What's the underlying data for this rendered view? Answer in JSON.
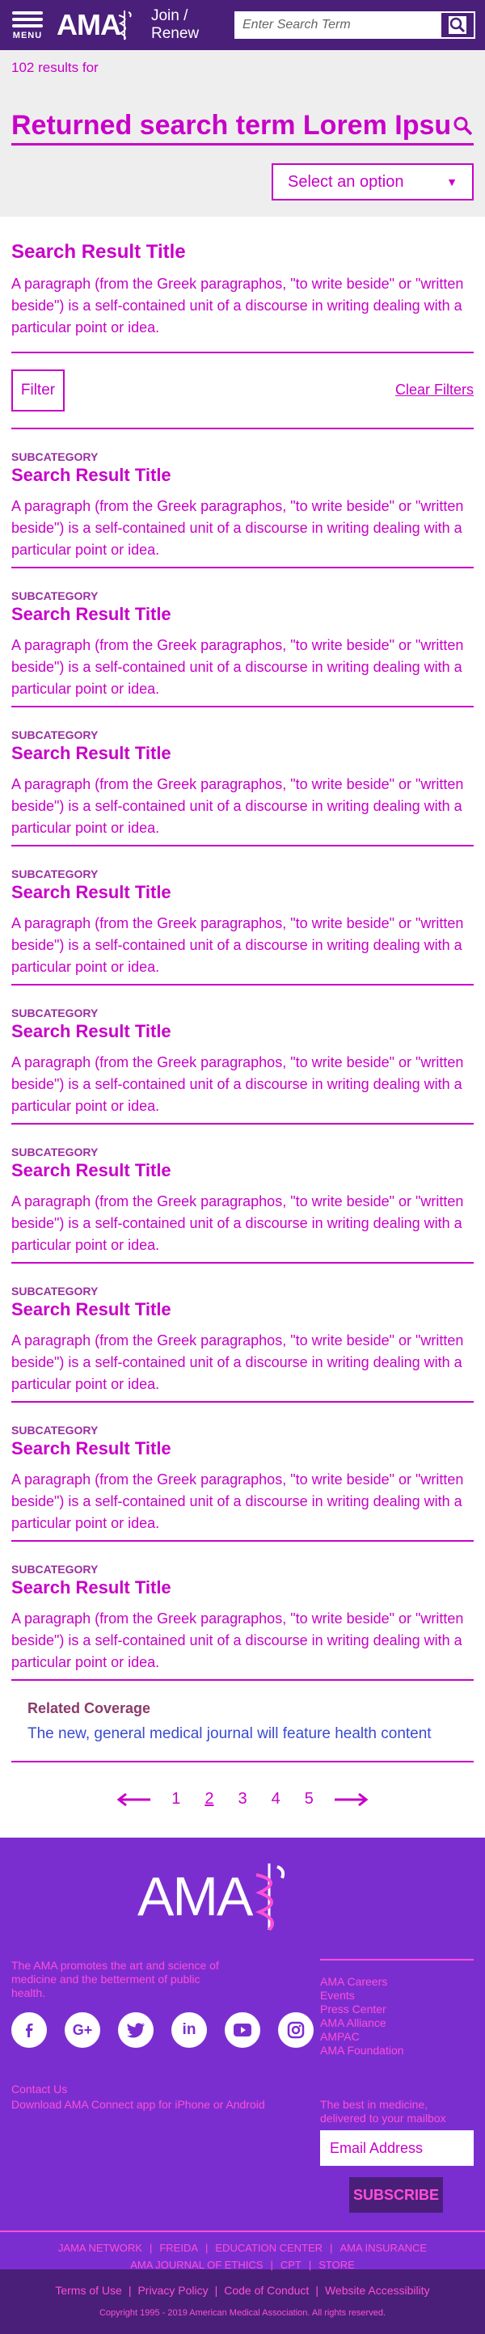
{
  "header": {
    "menu_label": "MENU",
    "logo_text": "AMA",
    "join_line1": "Join /",
    "join_line2": "Renew",
    "search_placeholder": "Enter Search Term"
  },
  "results": {
    "count_text": "102 results for",
    "search_term": "Returned search term Lorem Ipsum",
    "select_label": "Select an option"
  },
  "featured": {
    "title": "Search Result Title",
    "description": "A paragraph (from the Greek paragraphos, \"to write beside\" or \"written beside\") is a self-contained unit of a discourse in writing dealing with a particular point or idea."
  },
  "filters": {
    "filter_label": "Filter",
    "clear_label": "Clear Filters"
  },
  "items": [
    {
      "subcategory": "SUBCATEGORY",
      "title": "Search Result Title",
      "description": "A paragraph (from the Greek paragraphos, \"to write beside\" or \"written beside\") is a self-contained unit of a discourse in writing dealing with a particular point or idea."
    },
    {
      "subcategory": "SUBCATEGORY",
      "title": "Search Result Title",
      "description": "A paragraph (from the Greek paragraphos, \"to write beside\" or \"written beside\") is a self-contained unit of a discourse in writing dealing with a particular point or idea."
    },
    {
      "subcategory": "SUBCATEGORY",
      "title": "Search Result Title",
      "description": "A paragraph (from the Greek paragraphos, \"to write beside\" or \"written beside\") is a self-contained unit of a discourse in writing dealing with a particular point or idea."
    },
    {
      "subcategory": "SUBCATEGORY",
      "title": "Search Result Title",
      "description": "A paragraph (from the Greek paragraphos, \"to write beside\" or \"written beside\") is a self-contained unit of a discourse in writing dealing with a particular point or idea."
    },
    {
      "subcategory": "SUBCATEGORY",
      "title": "Search Result Title",
      "description": "A paragraph (from the Greek paragraphos, \"to write beside\" or \"written beside\") is a self-contained unit of a discourse in writing dealing with a particular point or idea."
    },
    {
      "subcategory": "SUBCATEGORY",
      "title": "Search Result Title",
      "description": "A paragraph (from the Greek paragraphos, \"to write beside\" or \"written beside\") is a self-contained unit of a discourse in writing dealing with a particular point or idea."
    },
    {
      "subcategory": "SUBCATEGORY",
      "title": "Search Result Title",
      "description": "A paragraph (from the Greek paragraphos, \"to write beside\" or \"written beside\") is a self-contained unit of a discourse in writing dealing with a particular point or idea."
    },
    {
      "subcategory": "SUBCATEGORY",
      "title": "Search Result Title",
      "description": "A paragraph (from the Greek paragraphos, \"to write beside\" or \"written beside\") is a self-contained unit of a discourse in writing dealing with a particular point or idea."
    },
    {
      "subcategory": "SUBCATEGORY",
      "title": "Search Result Title",
      "description": "A paragraph (from the Greek paragraphos, \"to write beside\" or \"written beside\") is a self-contained unit of a discourse in writing dealing with a particular point or idea."
    }
  ],
  "related": {
    "heading": "Related Coverage",
    "link": "The new, general medical journal will feature health content"
  },
  "pagination": {
    "pages": [
      "1",
      "2",
      "3",
      "4",
      "5"
    ],
    "current": "2"
  },
  "footer": {
    "logo_text": "AMA",
    "mission": "The AMA promotes the art and science of medicine and the betterment of public health.",
    "links": [
      "AMA Careers",
      "Events",
      "Press Center",
      "AMA Alliance",
      "AMPAC",
      "AMA Foundation"
    ],
    "socials": [
      "facebook-icon",
      "google-plus-icon",
      "twitter-icon",
      "linkedin-icon",
      "youtube-icon",
      "instagram-icon"
    ],
    "contact": "Contact Us",
    "app": "Download AMA Connect app for iPhone or Android",
    "newsletter_line1": "The best in medicine,",
    "newsletter_line2": "delivered to your mailbox",
    "email_placeholder": "Email Address",
    "subscribe": "SUBSCRIBE",
    "nav_row1": [
      "JAMA NETWORK",
      "FREIDA",
      "EDUCATION CENTER",
      "AMA INSURANCE"
    ],
    "nav_row2": [
      "AMA JOURNAL OF ETHICS",
      "CPT",
      "STORE"
    ]
  },
  "bottom": {
    "links": [
      "Terms of Use",
      "Privacy Policy",
      "Code of Conduct",
      "Website Accessibility"
    ],
    "copyright": "Copyright 1995 - 2019 American Medical Association. All rights reserved."
  },
  "colors": {
    "header_purple": "#4a1f7a",
    "accent_magenta": "#c800c8",
    "footer_purple": "#7b2ed0",
    "footer_pink": "#ff4fd8"
  }
}
